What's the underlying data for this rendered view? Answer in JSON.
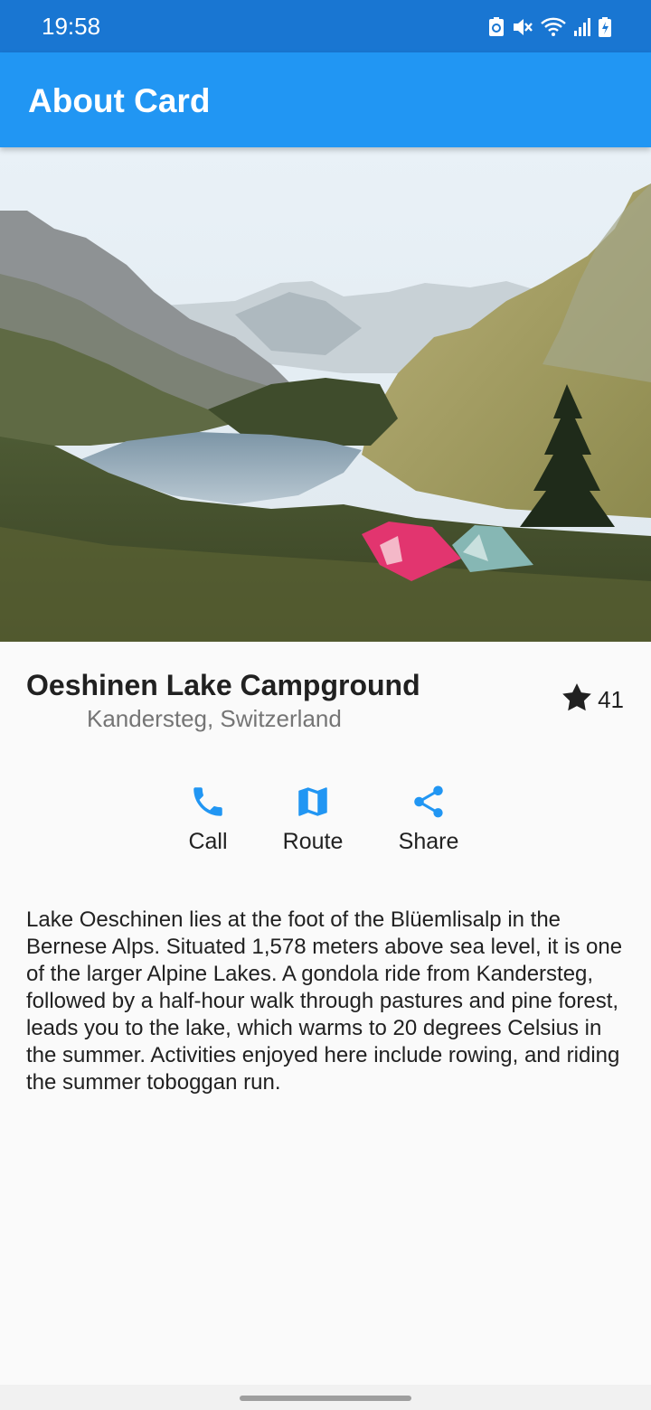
{
  "status_bar": {
    "time": "19:58",
    "icons": [
      "recycle-icon",
      "mute-icon",
      "wifi-icon",
      "signal-icon",
      "battery-charging-icon"
    ]
  },
  "app_bar": {
    "title": "About Card",
    "color": "#2196f3"
  },
  "hero": {
    "alt": "Lake Oeschinen with tents in the Bernese Alps"
  },
  "place": {
    "name": "Oeshinen Lake Campground",
    "location": "Kandersteg, Switzerland",
    "rating_icon": "star-icon",
    "rating_count": "41"
  },
  "actions": [
    {
      "label": "Call",
      "icon": "phone-icon"
    },
    {
      "label": "Route",
      "icon": "map-icon"
    },
    {
      "label": "Share",
      "icon": "share-icon"
    }
  ],
  "accent_color": "#2196f3",
  "description": "Lake Oeschinen lies at the foot of the Blüemlisalp in the Bernese Alps. Situated 1,578 meters above sea level, it is one of the larger Alpine Lakes. A gondola ride from Kandersteg, followed by a half-hour walk through pastures and pine forest, leads you to the lake, which warms to 20 degrees Celsius in the summer. Activities enjoyed here include rowing, and riding the summer toboggan run."
}
